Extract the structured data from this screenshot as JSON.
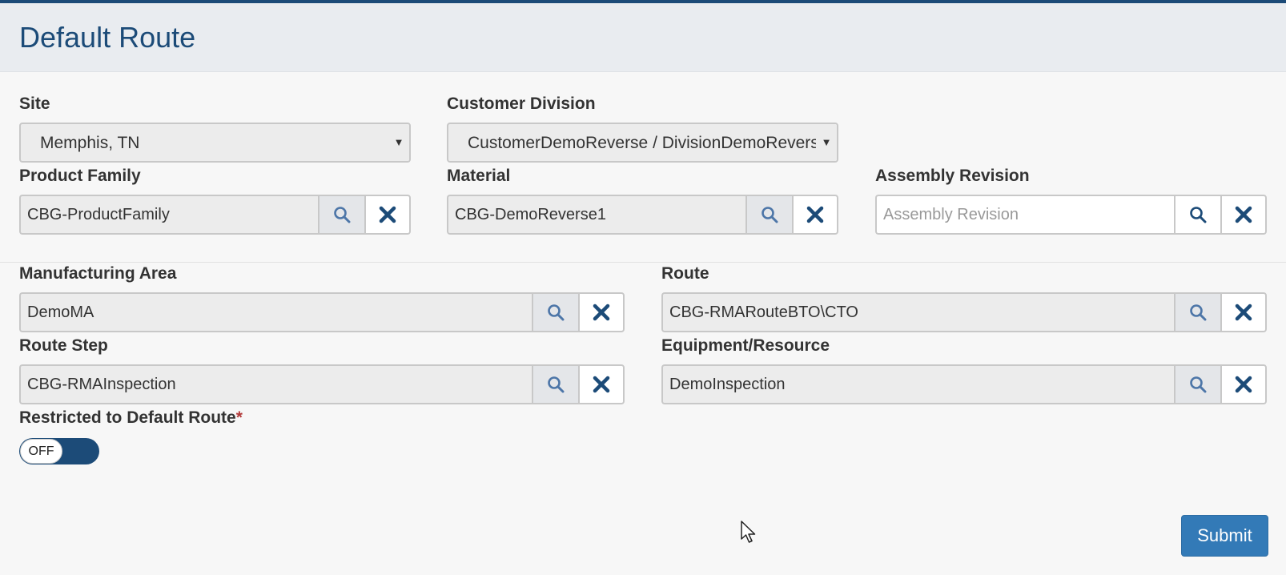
{
  "page": {
    "title": "Default Route"
  },
  "colors": {
    "brand": "#1c4b78",
    "submit": "#337ab7",
    "required": "#b23a3a"
  },
  "site": {
    "label": "Site",
    "value": "Memphis, TN"
  },
  "customer_division": {
    "label": "Customer Division",
    "value": "CustomerDemoReverse / DivisionDemoReverse"
  },
  "product_family": {
    "label": "Product Family",
    "value": "CBG-ProductFamily"
  },
  "material": {
    "label": "Material",
    "value": "CBG-DemoReverse1"
  },
  "assembly_revision": {
    "label": "Assembly Revision",
    "value": "",
    "placeholder": "Assembly Revision"
  },
  "manufacturing_area": {
    "label": "Manufacturing Area",
    "value": "DemoMA"
  },
  "route": {
    "label": "Route",
    "value": "CBG-RMARouteBTO\\CTO"
  },
  "route_step": {
    "label": "Route Step",
    "value": "CBG-RMAInspection"
  },
  "equipment": {
    "label": "Equipment/Resource",
    "value": "DemoInspection"
  },
  "restricted": {
    "label": "Restricted to Default Route",
    "required_mark": "*",
    "state": "OFF"
  },
  "actions": {
    "submit": "Submit"
  },
  "icons": {
    "search": "search-icon",
    "clear": "close-icon",
    "dropdown": "caret-down-icon"
  }
}
